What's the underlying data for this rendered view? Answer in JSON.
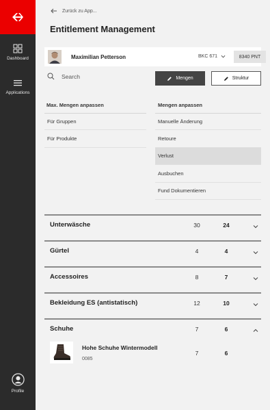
{
  "sidebar": {
    "logo_icon": "sbb-logo-icon",
    "items": [
      {
        "label": "Dashboard",
        "icon": "dashboard-grid-icon"
      },
      {
        "label": "Applications",
        "icon": "hamburger-menu-icon"
      }
    ],
    "profile": {
      "label": "Profile",
      "icon": "user-circle-icon"
    }
  },
  "header": {
    "back_label": "Zurück zu App...",
    "title": "Entitlement Management"
  },
  "user": {
    "name": "Maximilian Petterson",
    "account": "BKC 671",
    "points": "8340 PNT"
  },
  "toolbar": {
    "search_placeholder": "Search",
    "mengen_label": "Mengen",
    "struktur_label": "Struktur"
  },
  "left_menu": {
    "heading": "Max. Mengen anpassen",
    "items": [
      "Für Gruppen",
      "Für Produkte"
    ]
  },
  "right_menu": {
    "heading": "Mengen anpassen",
    "items": [
      "Manuelle Änderung",
      "Retoure",
      "Verlust",
      "Ausbuchen",
      "Fund Dokumentieren"
    ],
    "active_index": 2
  },
  "categories": [
    {
      "name": "Unterwäsche",
      "max": "30",
      "current": "24",
      "expanded": false
    },
    {
      "name": "Gürtel",
      "max": "4",
      "current": "4",
      "expanded": false
    },
    {
      "name": "Accessoires",
      "max": "8",
      "current": "7",
      "expanded": false
    },
    {
      "name": "Bekleidung ES (antistatisch)",
      "max": "12",
      "current": "10",
      "expanded": false
    },
    {
      "name": "Schuhe",
      "max": "7",
      "current": "6",
      "expanded": true
    }
  ],
  "product": {
    "name": "Hohe Schuhe Wintermodell",
    "code": "0085",
    "max": "7",
    "current": "6"
  },
  "colors": {
    "brand_red": "#eb0000",
    "sidebar_bg": "#2b2b2b",
    "primary_button": "#444444"
  }
}
